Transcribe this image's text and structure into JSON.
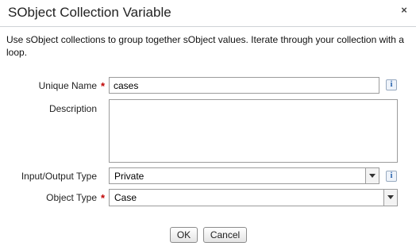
{
  "dialog": {
    "title": "SObject Collection Variable",
    "close_icon": "×",
    "description": "Use sObject collections to group together sObject values. Iterate through your collection with a loop."
  },
  "fields": {
    "unique_name": {
      "label": "Unique Name",
      "required": "*",
      "value": "cases"
    },
    "description": {
      "label": "Description",
      "value": ""
    },
    "io_type": {
      "label": "Input/Output Type",
      "selected": "Private"
    },
    "object_type": {
      "label": "Object Type",
      "required": "*",
      "value": "Case"
    }
  },
  "info_icon_glyph": "i",
  "buttons": {
    "ok": "OK",
    "cancel": "Cancel"
  }
}
